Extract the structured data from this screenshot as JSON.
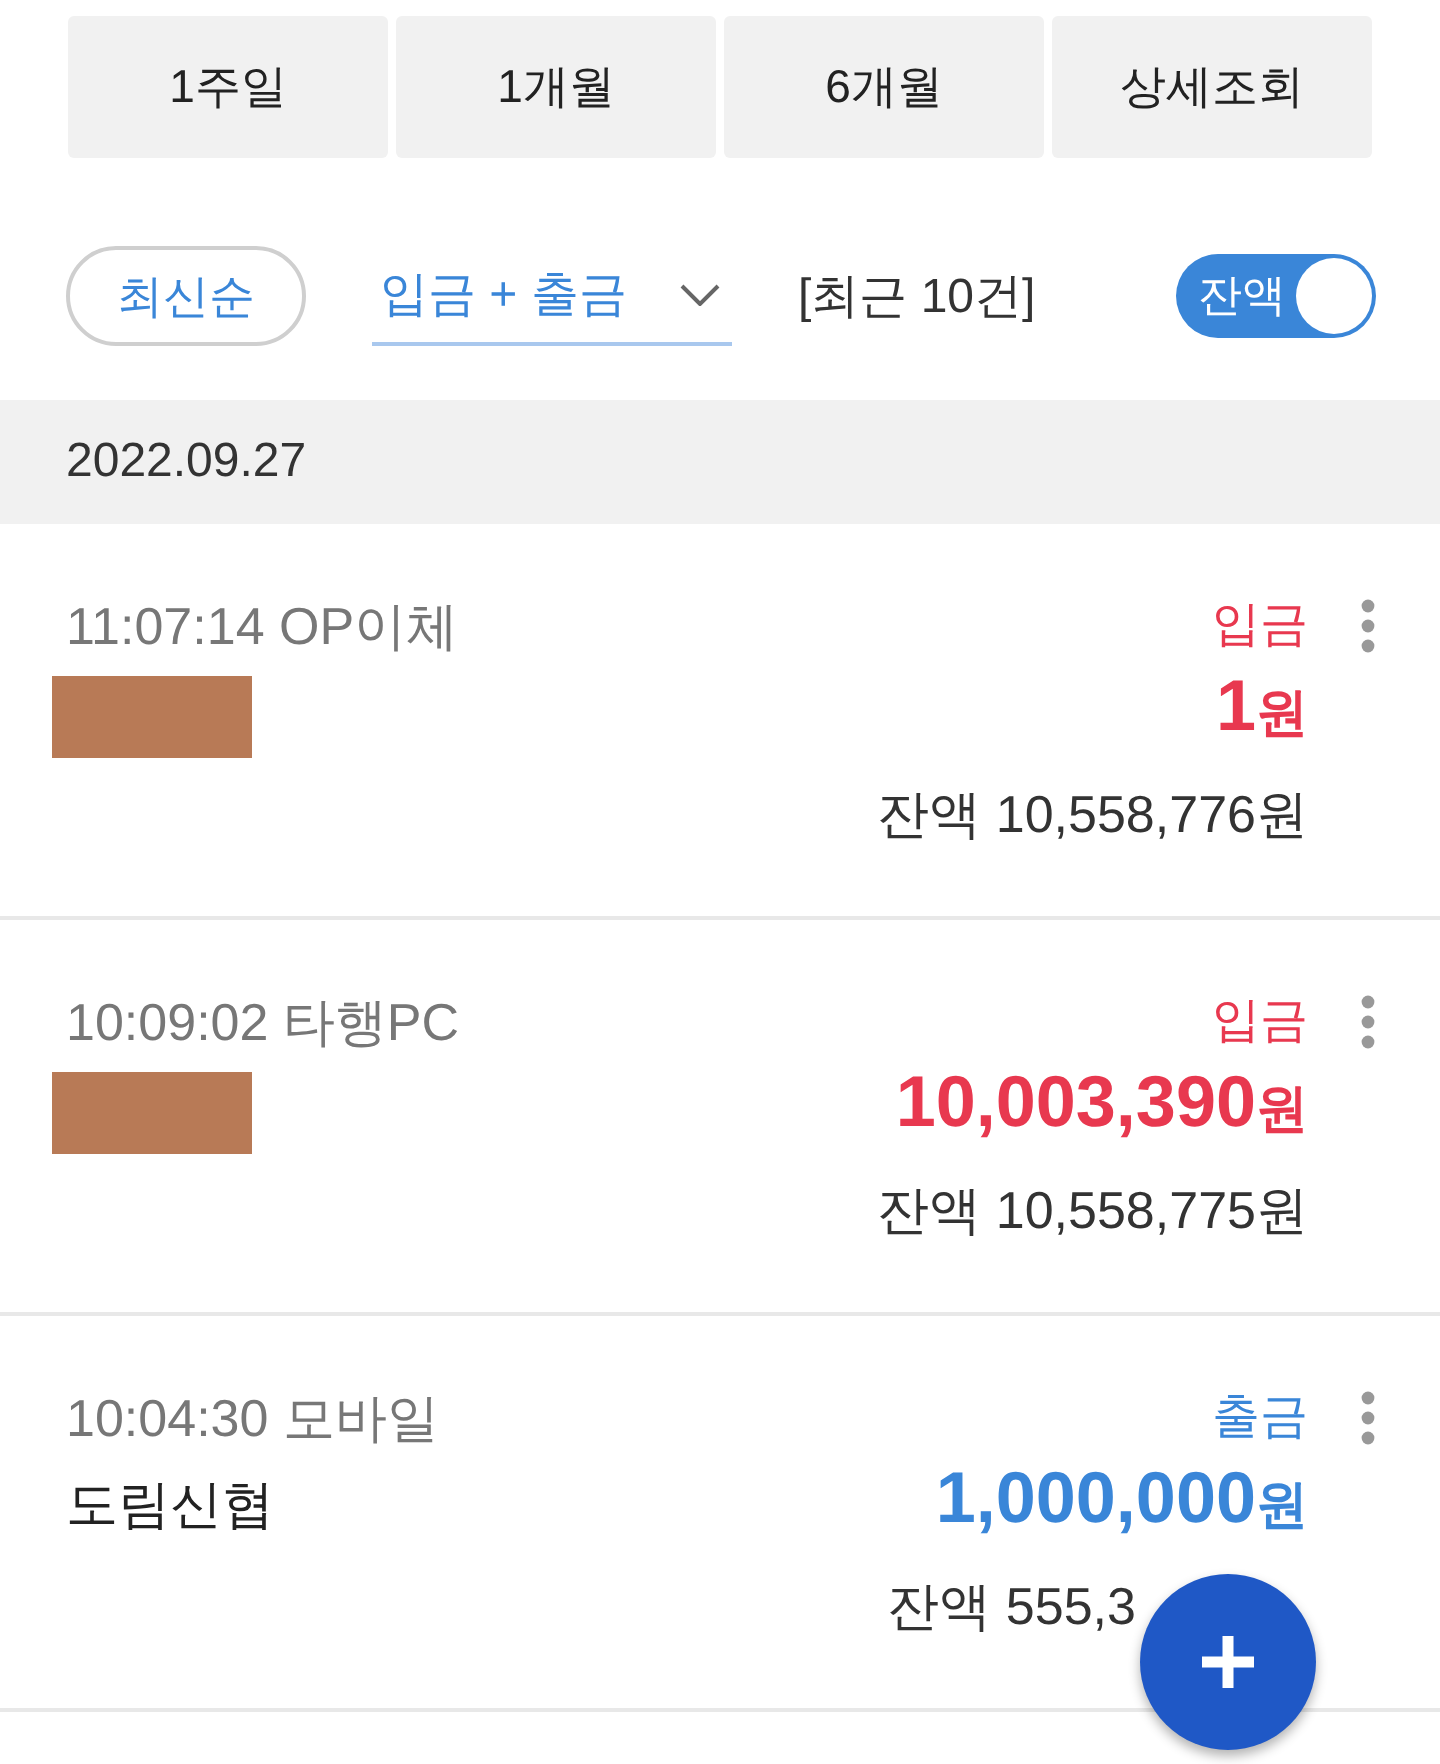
{
  "period_buttons": [
    "1주일",
    "1개월",
    "6개월",
    "상세조회"
  ],
  "filter_bar": {
    "sort": "최신순",
    "type_filter": "입금 + 출금",
    "count": "[최근 10건]",
    "balance_toggle": {
      "label": "잔액",
      "on": true
    }
  },
  "date_group": {
    "date": "2022.09.27",
    "transactions": [
      {
        "time": "11:07:14 OP이체",
        "redacted": true,
        "kind": "deposit",
        "type_label": "입금",
        "amount": "1",
        "unit": "원",
        "balance": "잔액 10,558,776원"
      },
      {
        "time": "10:09:02 타행PC",
        "redacted": true,
        "kind": "deposit",
        "type_label": "입금",
        "amount": "10,003,390",
        "unit": "원",
        "balance": "잔액 10,558,775원"
      },
      {
        "time": "10:04:30 모바일",
        "redacted": false,
        "counterparty": "도림신협",
        "kind": "withdrawal",
        "type_label": "출금",
        "amount": "1,000,000",
        "unit": "원",
        "balance": "잔액 555,3"
      }
    ]
  }
}
